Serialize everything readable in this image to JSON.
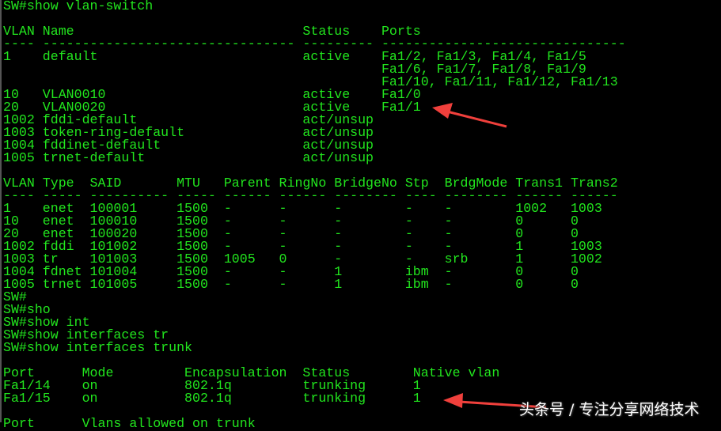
{
  "colors": {
    "text": "#22e61e",
    "background": "#000000",
    "arrow": "#f0403c"
  },
  "lines": [
    "SW#show vlan-switch",
    "",
    "VLAN Name                             Status    Ports",
    "---- -------------------------------- --------- -------------------------------",
    "1    default                          active    Fa1/2, Fa1/3, Fa1/4, Fa1/5",
    "                                                Fa1/6, Fa1/7, Fa1/8, Fa1/9",
    "                                                Fa1/10, Fa1/11, Fa1/12, Fa1/13",
    "10   VLAN0010                         active    Fa1/0",
    "20   VLAN0020                         active    Fa1/1",
    "1002 fddi-default                     act/unsup",
    "1003 token-ring-default               act/unsup",
    "1004 fddinet-default                  act/unsup",
    "1005 trnet-default                    act/unsup",
    "",
    "VLAN Type  SAID       MTU   Parent RingNo BridgeNo Stp  BrdgMode Trans1 Trans2",
    "---- ----- ---------- ----- ------ ------ -------- ---- -------- ------ ------",
    "1    enet  100001     1500  -      -      -        -    -        1002   1003",
    "10   enet  100010     1500  -      -      -        -    -        0      0",
    "20   enet  100020     1500  -      -      -        -    -        0      0",
    "1002 fddi  101002     1500  -      -      -        -    -        1      1003",
    "1003 tr    101003     1500  1005   0      -        -    srb      1      1002",
    "1004 fdnet 101004     1500  -      -      1        ibm  -        0      0",
    "1005 trnet 101005     1500  -      -      1        ibm  -        0      0",
    "SW#",
    "SW#sho",
    "SW#show int",
    "SW#show interfaces tr",
    "SW#show interfaces trunk",
    "",
    "Port      Mode         Encapsulation  Status        Native vlan",
    "Fa1/14    on           802.1q         trunking      1",
    "Fa1/15    on           802.1q         trunking      1",
    "",
    "Port      Vlans allowed on trunk"
  ],
  "watermark": "头条号 / 专注分享网络技术"
}
